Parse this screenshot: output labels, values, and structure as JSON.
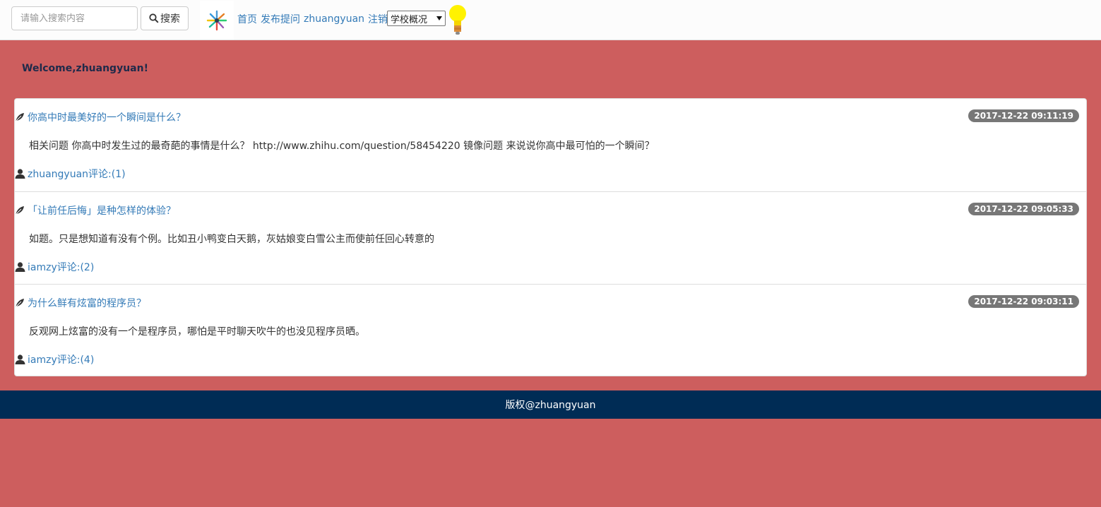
{
  "nav": {
    "search_placeholder": "请输入搜索内容",
    "search_label": "搜索",
    "links": [
      "首页",
      "发布提问",
      "zhuangyuan",
      "注销"
    ],
    "select_value": "学校概况"
  },
  "welcome": "Welcome,zhuangyuan!",
  "questions": [
    {
      "title": "你高中时最美好的一个瞬间是什么？",
      "time": "2017-12-22 09:11:19",
      "body": "相关问题 你高中时发生过的最奇葩的事情是什么？ http://www.zhihu.com/question/58454220 镜像问题 来说说你高中最可怕的一个瞬间？",
      "author_comments": "zhuangyuan评论:(1)"
    },
    {
      "title": "「让前任后悔」是种怎样的体验？",
      "time": "2017-12-22 09:05:33",
      "body": "如题。只是想知道有没有个例。比如丑小鸭变白天鹅，灰姑娘变白雪公主而使前任回心转意的",
      "author_comments": "iamzy评论:(2)"
    },
    {
      "title": "为什么鲜有炫富的程序员？",
      "time": "2017-12-22 09:03:11",
      "body": "反观网上炫富的没有一个是程序员，哪怕是平时聊天吹牛的也没见程序员晒。",
      "author_comments": "iamzy评论:(4)"
    }
  ],
  "footer": "版权@zhuangyuan",
  "colors": {
    "page_bg": "#cd5e5e",
    "link": "#337ab7",
    "badge": "#777777",
    "footer_bg": "#002c55"
  },
  "icons": [
    "search-icon",
    "logo-icon",
    "lightbulb-icon",
    "leaf-icon",
    "user-icon",
    "caret-down-icon"
  ]
}
